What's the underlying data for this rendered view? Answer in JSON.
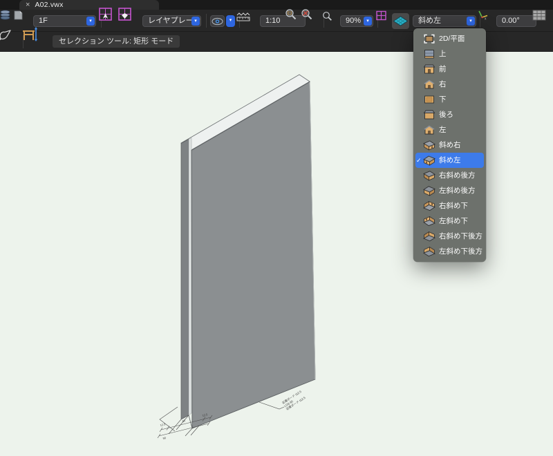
{
  "window": {
    "tab_title": "A02.vwx"
  },
  "glyphs": {
    "dropdown_arrow": "▾",
    "checkmark": "✓",
    "close": "×"
  },
  "toolbar_main": {
    "layer_field": {
      "value": "1F"
    },
    "layer_plane_field": {
      "value": "レイヤプレーン"
    },
    "scale_field": {
      "value": "1:10"
    },
    "zoom_field": {
      "value": "90%"
    },
    "view_field": {
      "value": "斜め左"
    },
    "angle_field": {
      "value": "0.00°"
    },
    "icons": [
      "layers-icon",
      "sheet-icon",
      "design-layer-grid-icon",
      "design-layer-cube-icon",
      "visibility-eye-icon",
      "visibility-dropdown-icon",
      "scale-ruler-icon",
      "zoom-marquee-icon",
      "zoom-pan-icon",
      "zoom-level-icon",
      "multi-pane-icon",
      "working-plane-icon",
      "axis-rotation-icon",
      "worksheet-icon"
    ]
  },
  "tool_bar": {
    "status_text": "セレクション ツール: 矩形 モード",
    "icons": [
      "lasso-selection-icon",
      "wall-height-icon"
    ]
  },
  "view_menu": {
    "selected_index": 8,
    "items": [
      {
        "label": "2D/平面",
        "icon": "plan-view-icon",
        "selected": false
      },
      {
        "label": "上",
        "icon": "house-top-icon",
        "selected": false
      },
      {
        "label": "前",
        "icon": "house-front-icon",
        "selected": false
      },
      {
        "label": "右",
        "icon": "house-right-icon",
        "selected": false
      },
      {
        "label": "下",
        "icon": "house-bottom-icon",
        "selected": false
      },
      {
        "label": "後ろ",
        "icon": "house-back-icon",
        "selected": false
      },
      {
        "label": "左",
        "icon": "house-left-icon",
        "selected": false
      },
      {
        "label": "斜め右",
        "icon": "house-iso-right-icon",
        "selected": false
      },
      {
        "label": "斜め左",
        "icon": "house-iso-left-icon",
        "selected": true
      },
      {
        "label": "右斜め後方",
        "icon": "house-iso-right-back-icon",
        "selected": false
      },
      {
        "label": "左斜め後方",
        "icon": "house-iso-left-back-icon",
        "selected": false
      },
      {
        "label": "右斜め下",
        "icon": "house-iso-right-under-icon",
        "selected": false
      },
      {
        "label": "左斜め下",
        "icon": "house-iso-left-under-icon",
        "selected": false
      },
      {
        "label": "右斜め下後方",
        "icon": "house-iso-right-under-back-icon",
        "selected": false
      },
      {
        "label": "左斜め下後方",
        "icon": "house-iso-left-under-back-icon",
        "selected": false
      }
    ]
  },
  "canvas": {
    "wall_leader_lines": [
      "石膏ボード t12.5",
      "LGS 65",
      "石膏ボード t12.5"
    ],
    "dimension_labels": {
      "d1": "12.5",
      "d2": "65",
      "d3": "12.5",
      "total": "90"
    }
  },
  "colors": {
    "canvas_bg": "#edf3ec",
    "toolbar_bg": "#272727",
    "tab_bg": "#1a1a1a",
    "tab_active": "#2e2e2e",
    "field_bg": "#3d3d3f",
    "accent_blue": "#2e66e0",
    "menu_bg": "#6d716c",
    "menu_highlight": "#3d7bea",
    "panel_face": "#8b8f91",
    "magenta_icon": "#c554cf",
    "teal_icon": "#28b7cc"
  }
}
